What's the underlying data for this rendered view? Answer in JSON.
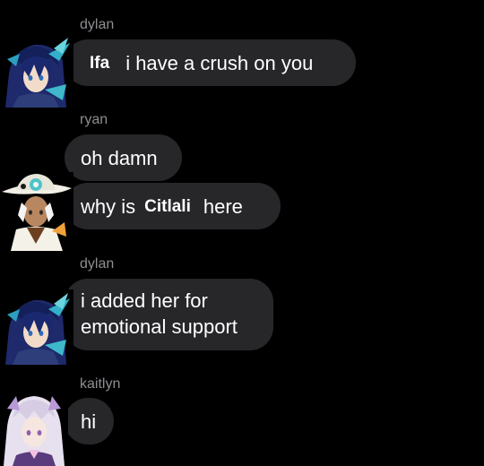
{
  "messages": [
    {
      "sender": "dylan",
      "avatar_icon": "blue-haired-character-avatar-icon",
      "bubbles": [
        {
          "mention": "Ifa",
          "text": "i have a crush on you"
        }
      ]
    },
    {
      "sender": "ryan",
      "avatar_icon": "cowboy-hat-character-avatar-icon",
      "bubbles": [
        {
          "text": "oh damn"
        },
        {
          "text_before": "why is",
          "mention": "Citlali",
          "text_after": "here"
        }
      ]
    },
    {
      "sender": "dylan",
      "avatar_icon": "blue-haired-character-avatar-icon",
      "bubbles": [
        {
          "line1": "i added her for",
          "line2": "emotional support"
        }
      ]
    },
    {
      "sender": "kaitlyn",
      "avatar_icon": "silver-haired-character-avatar-icon",
      "bubbles": [
        {
          "text": "hi"
        }
      ]
    }
  ],
  "colors": {
    "background": "#000000",
    "bubble": "#27272a",
    "sender_name": "#8e8e93",
    "text": "#ffffff"
  }
}
